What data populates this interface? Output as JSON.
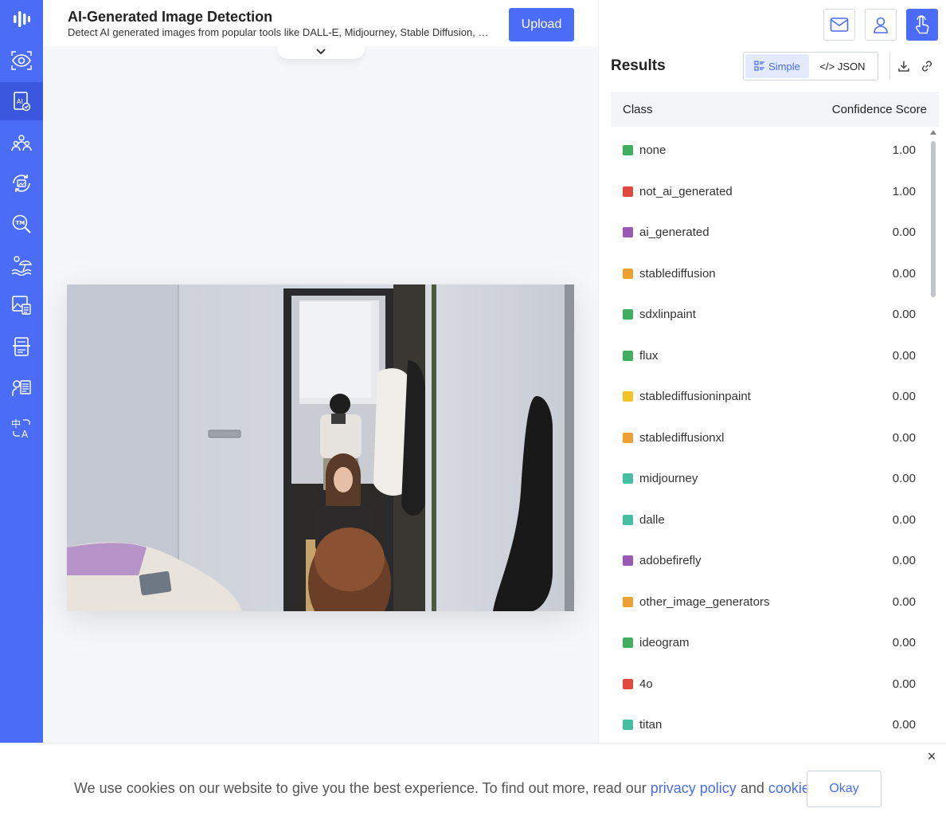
{
  "app": {
    "title": "AI-Generated Image Detection",
    "subtitle": "Detect AI generated images from popular tools like DALL-E, Midjourney, Stable Diffusion, and...",
    "upload_label": "Upload"
  },
  "sidebar": {
    "items": [
      {
        "icon": "logo-icon",
        "active": false
      },
      {
        "icon": "eye-scan-icon",
        "active": false
      },
      {
        "icon": "ai-image-icon",
        "active": true
      },
      {
        "icon": "people-icon",
        "active": false
      },
      {
        "icon": "image-refresh-icon",
        "active": false
      },
      {
        "icon": "trademark-search-icon",
        "active": false
      },
      {
        "icon": "beach-icon",
        "active": false
      },
      {
        "icon": "image-doc-icon",
        "active": false
      },
      {
        "icon": "document-scan-icon",
        "active": false
      },
      {
        "icon": "speech-doc-icon",
        "active": false
      },
      {
        "icon": "translate-icon",
        "active": false
      }
    ]
  },
  "header_actions": [
    {
      "icon": "mail-icon"
    },
    {
      "icon": "user-icon"
    },
    {
      "icon": "touch-icon"
    }
  ],
  "results": {
    "title": "Results",
    "view_simple": "Simple",
    "view_json": "</> JSON",
    "column_class": "Class",
    "column_score": "Confidence Score",
    "rows": [
      {
        "label": "none",
        "score": "1.00",
        "color": "#3fae5f"
      },
      {
        "label": "not_ai_generated",
        "score": "1.00",
        "color": "#e0493b"
      },
      {
        "label": "ai_generated",
        "score": "0.00",
        "color": "#9b59b6"
      },
      {
        "label": "stablediffusion",
        "score": "0.00",
        "color": "#f0a030"
      },
      {
        "label": "sdxlinpaint",
        "score": "0.00",
        "color": "#3fae5f"
      },
      {
        "label": "flux",
        "score": "0.00",
        "color": "#3fae5f"
      },
      {
        "label": "stablediffusioninpaint",
        "score": "0.00",
        "color": "#f2c326"
      },
      {
        "label": "stablediffusionxl",
        "score": "0.00",
        "color": "#f0a030"
      },
      {
        "label": "midjourney",
        "score": "0.00",
        "color": "#45bfa0"
      },
      {
        "label": "dalle",
        "score": "0.00",
        "color": "#45bfa0"
      },
      {
        "label": "adobefirefly",
        "score": "0.00",
        "color": "#9b59b6"
      },
      {
        "label": "other_image_generators",
        "score": "0.00",
        "color": "#f0a030"
      },
      {
        "label": "ideogram",
        "score": "0.00",
        "color": "#3fae5f"
      },
      {
        "label": "4o",
        "score": "0.00",
        "color": "#e0493b"
      },
      {
        "label": "titan",
        "score": "0.00",
        "color": "#45bfa0"
      }
    ]
  },
  "cookie": {
    "text_before": "We use cookies on our website to give you the best experience. To find out more, read our ",
    "privacy_link": "privacy policy",
    "text_middle": " and ",
    "cookie_link": "cookie policy",
    "text_after": ".",
    "okay_label": "Okay",
    "close_label": "×"
  },
  "colors": {
    "accent": "#4a6cf7",
    "sidebar_active": "#3a58dd"
  }
}
